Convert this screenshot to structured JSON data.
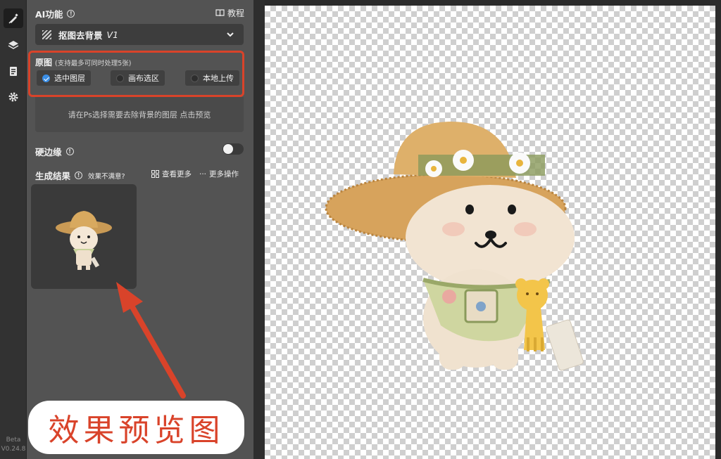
{
  "ai_section": {
    "title": "AI功能",
    "tutorial_label": "教程"
  },
  "model_select": {
    "value": "抠图去背景",
    "version": "V1"
  },
  "source": {
    "label": "原图",
    "hint": "(支持最多可同时处理5张)",
    "options": [
      {
        "label": "选中图层",
        "selected": true
      },
      {
        "label": "画布选区",
        "selected": false
      },
      {
        "label": "本地上传",
        "selected": false
      }
    ]
  },
  "preview_hint": "请在Ps选择需要去除背景的图层 点击预览",
  "hard_edge": {
    "label": "硬边缘",
    "enabled": false
  },
  "results": {
    "title": "生成结果",
    "hint": "效果不满意?",
    "view_more": "查看更多",
    "more_actions": "更多操作"
  },
  "annotation": {
    "text": "效果预览图"
  },
  "version": {
    "channel": "Beta",
    "number": "V0.24.8"
  },
  "colors": {
    "highlight": "#d9432a",
    "accent": "#3a8ee6"
  },
  "icons": {
    "tools": [
      "brush-icon",
      "layers-icon",
      "clipboard-icon",
      "gear-icon"
    ]
  }
}
